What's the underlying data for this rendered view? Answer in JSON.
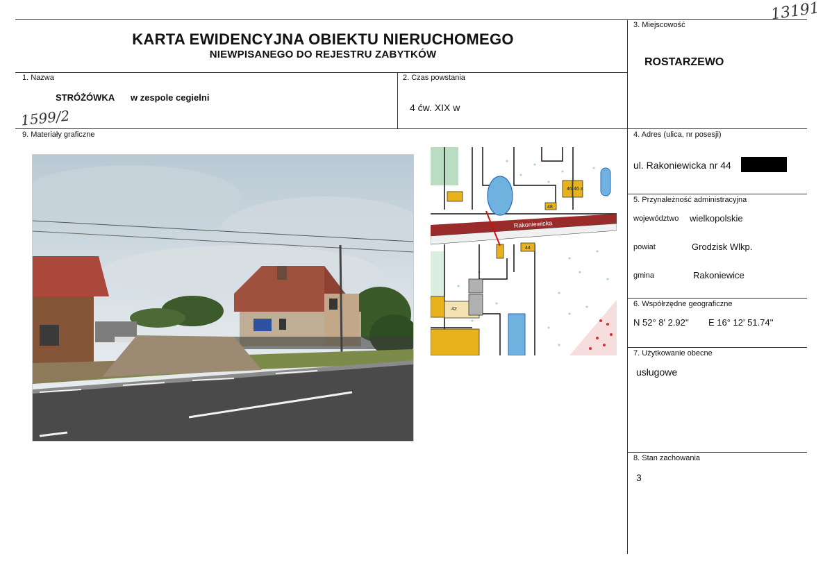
{
  "card": {
    "title": "KARTA EWIDENCYJNA OBIEKTU NIERUCHOMEGO",
    "subtitle": "NIEWPISANEGO DO REJESTRU ZABYTKÓW",
    "handwritten_top": "13191",
    "handwritten_left": "1599/2"
  },
  "fields": {
    "nazwa": {
      "label": "1. Nazwa",
      "main": "STRÓŻÓWKA",
      "extra": "w zespole cegielni"
    },
    "czas": {
      "label": "2. Czas powstania",
      "value": "4 ćw.  XIX w"
    },
    "miejscowosc": {
      "label": "3. Miejscowość",
      "value": "ROSTARZEWO"
    },
    "adres": {
      "label": "4. Adres (ulica, nr posesji)",
      "value": "ul. Rakoniewicka  nr 44"
    },
    "przynaleznosc": {
      "label": "5. Przynależność administracyjna",
      "wojewodztwo_label": "województwo",
      "wojewodztwo": "wielkopolskie",
      "powiat_label": "powiat",
      "powiat": "Grodzisk Wlkp.",
      "gmina_label": "gmina",
      "gmina": "Rakoniewice"
    },
    "wspolrzedne": {
      "label": "6. Współrzędne geograficzne",
      "n": "N  52° 8' 2.92''",
      "e": "E 16° 12' 51.74''"
    },
    "uzytkowanie": {
      "label": "7. Użytkowanie obecne",
      "value": "usługowe"
    },
    "stan": {
      "label": "8. Stan zachowania",
      "value": "3"
    },
    "materialy": {
      "label": "9. Materiały graficzne"
    }
  },
  "map": {
    "street": "Rakoniewicka",
    "house_numbers": [
      "46",
      "46 a",
      "48",
      "44",
      "42"
    ]
  }
}
